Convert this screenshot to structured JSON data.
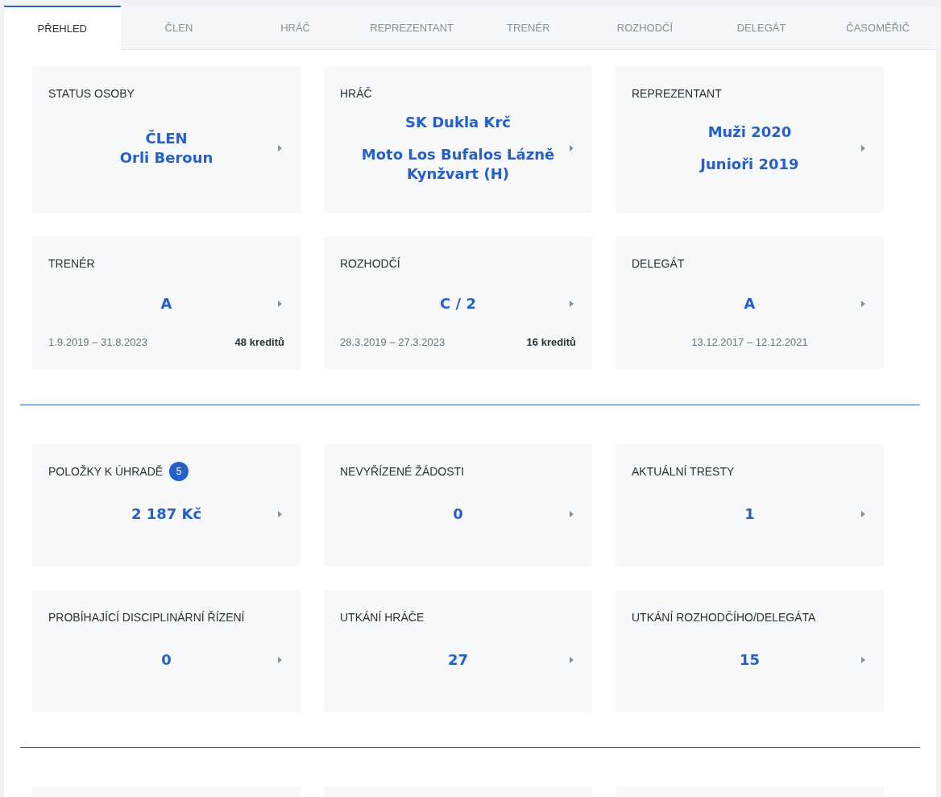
{
  "tabs": [
    {
      "label": "PŘEHLED",
      "selected": true
    },
    {
      "label": "ČLEN",
      "selected": false
    },
    {
      "label": "HRÁČ",
      "selected": false
    },
    {
      "label": "REPREZENTANT",
      "selected": false
    },
    {
      "label": "TRENÉR",
      "selected": false
    },
    {
      "label": "ROZHODČÍ",
      "selected": false
    },
    {
      "label": "DELEGÁT",
      "selected": false
    },
    {
      "label": "ČASOMĚŘIČ",
      "selected": false
    }
  ],
  "sections": [
    {
      "kind": "roles",
      "cards": [
        {
          "title": "STATUS OSOBY",
          "values": [
            [
              "ČLEN",
              "Orli Beroun"
            ]
          ]
        },
        {
          "title": "HRÁČ",
          "values": [
            [
              "SK Dukla Krč"
            ],
            [
              "Moto Los Bufalos Lázně Kynžvart (H)"
            ]
          ]
        },
        {
          "title": "REPREZENTANT",
          "values": [
            [
              "Muži 2020"
            ],
            [
              "Junioři 2019"
            ]
          ]
        },
        {
          "title": "TRENÉR",
          "values": [
            [
              "A"
            ]
          ],
          "dates": "1.9.2019 – 31.8.2023",
          "credits": "48 kreditů"
        },
        {
          "title": "ROZHODČÍ",
          "values": [
            [
              "C / 2"
            ]
          ],
          "dates": "28.3.2019 – 27.3.2023",
          "credits": "16 kreditů"
        },
        {
          "title": "DELEGÁT",
          "values": [
            [
              "A"
            ]
          ],
          "dates": "13.12.2017 – 12.12.2021"
        }
      ]
    },
    {
      "kind": "counts",
      "cards": [
        {
          "title": "POLOŽKY K ÚHRADĚ",
          "badge": "5",
          "values": [
            [
              "2 187 Kč"
            ]
          ]
        },
        {
          "title": "NEVYŘÍZENÉ ŽÁDOSTI",
          "values": [
            [
              "0"
            ]
          ]
        },
        {
          "title": "AKTUÁLNÍ TRESTY",
          "values": [
            [
              "1"
            ]
          ]
        },
        {
          "title": "PROBÍHAJÍCÍ DISCIPLINÁRNÍ ŘÍZENÍ",
          "values": [
            [
              "0"
            ]
          ]
        },
        {
          "title": "UTKÁNÍ HRÁČE",
          "values": [
            [
              "27"
            ]
          ]
        },
        {
          "title": "UTKÁNÍ ROZHODČÍHO/DELEGÁTA",
          "values": [
            [
              "15"
            ]
          ]
        }
      ]
    }
  ]
}
